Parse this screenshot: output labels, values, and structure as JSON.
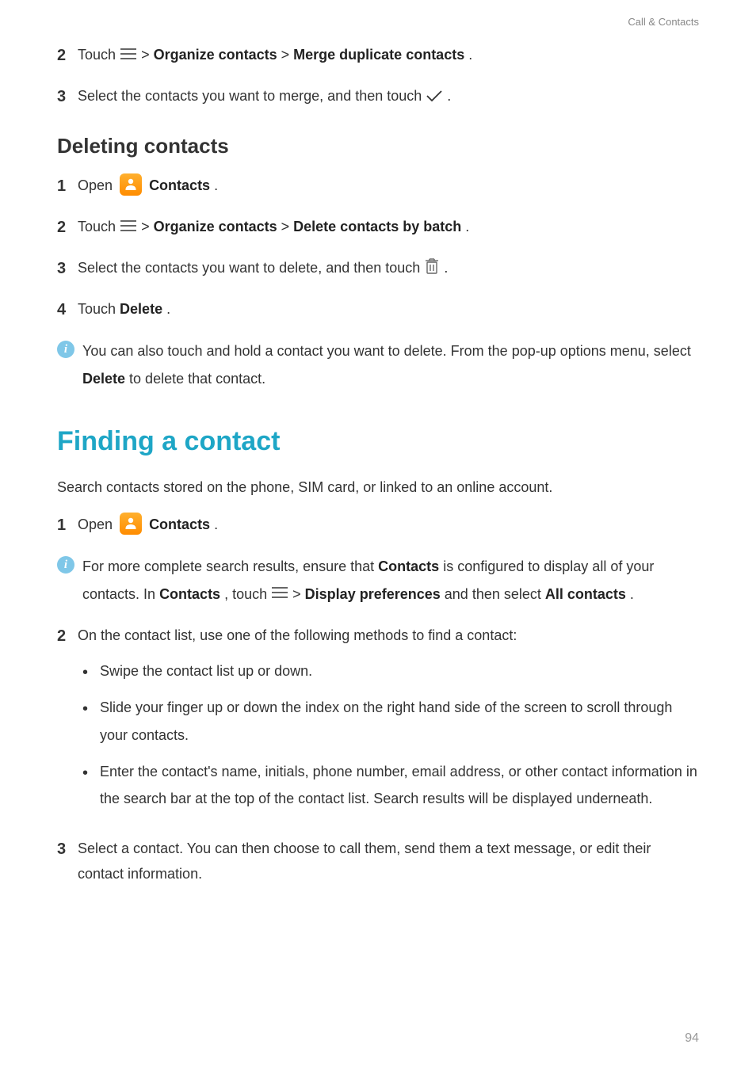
{
  "header": {
    "breadcrumb": "Call & Contacts"
  },
  "steps_top": {
    "s2": {
      "num": "2",
      "touch": "Touch ",
      "sep1": " > ",
      "orgcontacts": "Organize contacts",
      "sep2": " > ",
      "merge": "Merge duplicate contacts",
      "end": "."
    },
    "s3": {
      "num": "3",
      "pre": "Select the contacts you want to merge, and then touch ",
      "post": "."
    }
  },
  "section_deleting": {
    "title": "Deleting contacts",
    "s1": {
      "num": "1",
      "open": "Open ",
      "app": "Contacts",
      "end": "."
    },
    "s2": {
      "num": "2",
      "touch": "Touch ",
      "sep1": " > ",
      "orgcontacts": "Organize contacts",
      "sep2": " > ",
      "delbatch": "Delete contacts by batch",
      "end": "."
    },
    "s3": {
      "num": "3",
      "pre": "Select the contacts you want to delete, and then touch ",
      "post": "."
    },
    "s4": {
      "num": "4",
      "touch": "Touch ",
      "delete": "Delete",
      "end": "."
    },
    "info": {
      "pre": "You can also touch and hold a contact you want to delete. From the pop-up options menu, select ",
      "delete": "Delete",
      "post": " to delete that contact."
    }
  },
  "section_finding": {
    "title": "Finding a contact",
    "intro": "Search contacts stored on the phone, SIM card, or linked to an online account.",
    "s1": {
      "num": "1",
      "open": "Open ",
      "app": "Contacts",
      "end": "."
    },
    "info": {
      "pre": "For more complete search results, ensure that ",
      "contacts": "Contacts",
      "mid1": " is configured to display all of your contacts. In ",
      "contacts2": "Contacts",
      "mid2": ", touch ",
      "sep": " > ",
      "disp": "Display preferences",
      "mid3": " and then select ",
      "allc": "All contacts",
      "end": "."
    },
    "s2": {
      "num": "2",
      "text": "On the contact list, use one of the following methods to find a contact:"
    },
    "bullets": {
      "b1": "Swipe the contact list up or down.",
      "b2": "Slide your finger up or down the index on the right hand side of the screen to scroll through your contacts.",
      "b3": "Enter the contact's name, initials, phone number, email address, or other contact information in the search bar at the top of the contact list. Search results will be displayed underneath."
    },
    "s3": {
      "num": "3",
      "text": "Select a contact. You can then choose to call them, send them a text message, or edit their contact information."
    }
  },
  "page_number": "94"
}
